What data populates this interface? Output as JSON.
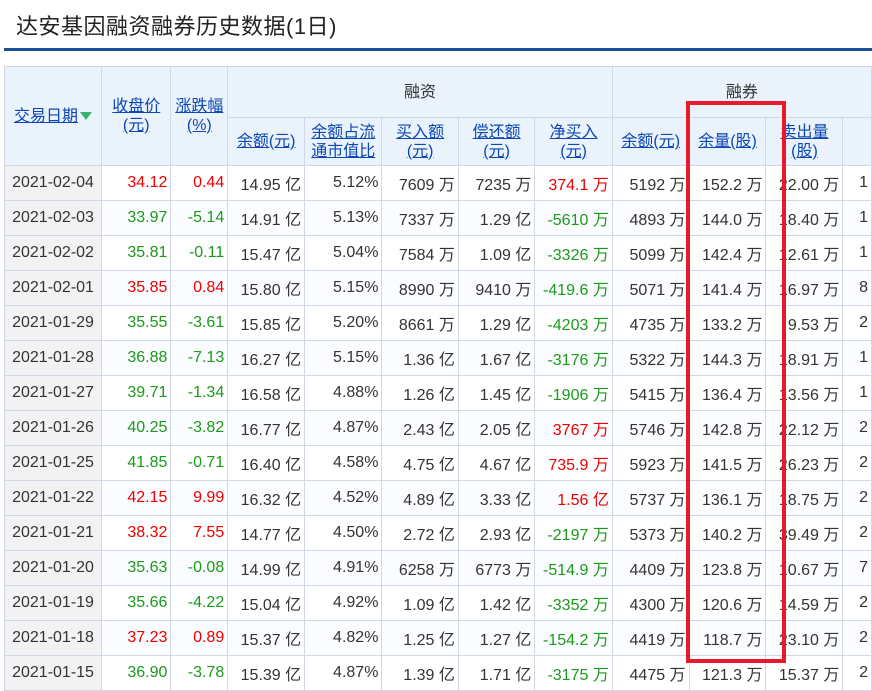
{
  "page": {
    "title": "达安基因融资融券历史数据(1日)"
  },
  "table": {
    "group_headers": {
      "financing": "融资",
      "securities_lending": "融券"
    },
    "columns": {
      "date": "交易日期",
      "close_line1": "收盘价",
      "close_line2": "(元)",
      "change_line1": "涨跌幅",
      "change_line2": "(%)",
      "fin_balance": "余额(元)",
      "fin_ratio_line1": "余额占流",
      "fin_ratio_line2": "通市值比",
      "fin_buy_line1": "买入额",
      "fin_buy_line2": "(元)",
      "fin_repay_line1": "偿还额",
      "fin_repay_line2": "(元)",
      "fin_net_line1": "净买入",
      "fin_net_line2": "(元)",
      "sl_balance": "余额(元)",
      "sl_volume": "余量(股)",
      "sl_sold_line1": "卖出量",
      "sl_sold_line2": "(股)",
      "sl_extra": ""
    },
    "rows": [
      {
        "date": "2021-02-04",
        "close": "34.12",
        "change": "0.44",
        "dir": "up",
        "fin_balance": "14.95 亿",
        "fin_ratio": "5.12%",
        "fin_buy": "7609 万",
        "fin_repay": "7235 万",
        "fin_net": "374.1 万",
        "net_dir": "up",
        "sl_balance": "5192 万",
        "sl_volume": "152.2 万",
        "sl_sold": "22.00 万",
        "sl_extra": "1"
      },
      {
        "date": "2021-02-03",
        "close": "33.97",
        "change": "-5.14",
        "dir": "down",
        "fin_balance": "14.91 亿",
        "fin_ratio": "5.13%",
        "fin_buy": "7337 万",
        "fin_repay": "1.29 亿",
        "fin_net": "-5610 万",
        "net_dir": "down",
        "sl_balance": "4893 万",
        "sl_volume": "144.0 万",
        "sl_sold": "18.40 万",
        "sl_extra": "1"
      },
      {
        "date": "2021-02-02",
        "close": "35.81",
        "change": "-0.11",
        "dir": "down",
        "fin_balance": "15.47 亿",
        "fin_ratio": "5.04%",
        "fin_buy": "7584 万",
        "fin_repay": "1.09 亿",
        "fin_net": "-3326 万",
        "net_dir": "down",
        "sl_balance": "5099 万",
        "sl_volume": "142.4 万",
        "sl_sold": "12.61 万",
        "sl_extra": "1"
      },
      {
        "date": "2021-02-01",
        "close": "35.85",
        "change": "0.84",
        "dir": "up",
        "fin_balance": "15.80 亿",
        "fin_ratio": "5.15%",
        "fin_buy": "8990 万",
        "fin_repay": "9410 万",
        "fin_net": "-419.6 万",
        "net_dir": "down",
        "sl_balance": "5071 万",
        "sl_volume": "141.4 万",
        "sl_sold": "16.97 万",
        "sl_extra": "8"
      },
      {
        "date": "2021-01-29",
        "close": "35.55",
        "change": "-3.61",
        "dir": "down",
        "fin_balance": "15.85 亿",
        "fin_ratio": "5.20%",
        "fin_buy": "8661 万",
        "fin_repay": "1.29 亿",
        "fin_net": "-4203 万",
        "net_dir": "down",
        "sl_balance": "4735 万",
        "sl_volume": "133.2 万",
        "sl_sold": "9.53 万",
        "sl_extra": "2"
      },
      {
        "date": "2021-01-28",
        "close": "36.88",
        "change": "-7.13",
        "dir": "down",
        "fin_balance": "16.27 亿",
        "fin_ratio": "5.15%",
        "fin_buy": "1.36 亿",
        "fin_repay": "1.67 亿",
        "fin_net": "-3176 万",
        "net_dir": "down",
        "sl_balance": "5322 万",
        "sl_volume": "144.3 万",
        "sl_sold": "18.91 万",
        "sl_extra": "1"
      },
      {
        "date": "2021-01-27",
        "close": "39.71",
        "change": "-1.34",
        "dir": "down",
        "fin_balance": "16.58 亿",
        "fin_ratio": "4.88%",
        "fin_buy": "1.26 亿",
        "fin_repay": "1.45 亿",
        "fin_net": "-1906 万",
        "net_dir": "down",
        "sl_balance": "5415 万",
        "sl_volume": "136.4 万",
        "sl_sold": "13.56 万",
        "sl_extra": "1"
      },
      {
        "date": "2021-01-26",
        "close": "40.25",
        "change": "-3.82",
        "dir": "down",
        "fin_balance": "16.77 亿",
        "fin_ratio": "4.87%",
        "fin_buy": "2.43 亿",
        "fin_repay": "2.05 亿",
        "fin_net": "3767 万",
        "net_dir": "up",
        "sl_balance": "5746 万",
        "sl_volume": "142.8 万",
        "sl_sold": "22.12 万",
        "sl_extra": "2"
      },
      {
        "date": "2021-01-25",
        "close": "41.85",
        "change": "-0.71",
        "dir": "down",
        "fin_balance": "16.40 亿",
        "fin_ratio": "4.58%",
        "fin_buy": "4.75 亿",
        "fin_repay": "4.67 亿",
        "fin_net": "735.9 万",
        "net_dir": "up",
        "sl_balance": "5923 万",
        "sl_volume": "141.5 万",
        "sl_sold": "26.23 万",
        "sl_extra": "2"
      },
      {
        "date": "2021-01-22",
        "close": "42.15",
        "change": "9.99",
        "dir": "up",
        "fin_balance": "16.32 亿",
        "fin_ratio": "4.52%",
        "fin_buy": "4.89 亿",
        "fin_repay": "3.33 亿",
        "fin_net": "1.56 亿",
        "net_dir": "up",
        "sl_balance": "5737 万",
        "sl_volume": "136.1 万",
        "sl_sold": "18.75 万",
        "sl_extra": "2"
      },
      {
        "date": "2021-01-21",
        "close": "38.32",
        "change": "7.55",
        "dir": "up",
        "fin_balance": "14.77 亿",
        "fin_ratio": "4.50%",
        "fin_buy": "2.72 亿",
        "fin_repay": "2.93 亿",
        "fin_net": "-2197 万",
        "net_dir": "down",
        "sl_balance": "5373 万",
        "sl_volume": "140.2 万",
        "sl_sold": "39.49 万",
        "sl_extra": "2"
      },
      {
        "date": "2021-01-20",
        "close": "35.63",
        "change": "-0.08",
        "dir": "down",
        "fin_balance": "14.99 亿",
        "fin_ratio": "4.91%",
        "fin_buy": "6258 万",
        "fin_repay": "6773 万",
        "fin_net": "-514.9 万",
        "net_dir": "down",
        "sl_balance": "4409 万",
        "sl_volume": "123.8 万",
        "sl_sold": "10.67 万",
        "sl_extra": "7"
      },
      {
        "date": "2021-01-19",
        "close": "35.66",
        "change": "-4.22",
        "dir": "down",
        "fin_balance": "15.04 亿",
        "fin_ratio": "4.92%",
        "fin_buy": "1.09 亿",
        "fin_repay": "1.42 亿",
        "fin_net": "-3352 万",
        "net_dir": "down",
        "sl_balance": "4300 万",
        "sl_volume": "120.6 万",
        "sl_sold": "14.59 万",
        "sl_extra": "2"
      },
      {
        "date": "2021-01-18",
        "close": "37.23",
        "change": "0.89",
        "dir": "up",
        "fin_balance": "15.37 亿",
        "fin_ratio": "4.82%",
        "fin_buy": "1.25 亿",
        "fin_repay": "1.27 亿",
        "fin_net": "-154.2 万",
        "net_dir": "down",
        "sl_balance": "4419 万",
        "sl_volume": "118.7 万",
        "sl_sold": "23.10 万",
        "sl_extra": "2"
      },
      {
        "date": "2021-01-15",
        "close": "36.90",
        "change": "-3.78",
        "dir": "down",
        "fin_balance": "15.39 亿",
        "fin_ratio": "4.87%",
        "fin_buy": "1.39 亿",
        "fin_repay": "1.71 亿",
        "fin_net": "-3175 万",
        "net_dir": "down",
        "sl_balance": "4475 万",
        "sl_volume": "121.3 万",
        "sl_sold": "15.37 万",
        "sl_extra": "2"
      }
    ]
  },
  "colors": {
    "up": "#ee0000",
    "down": "#1b9a1b",
    "header_bg": "#eaf2fb",
    "accent": "#1d4e9a",
    "highlight_box": "#e8192c"
  },
  "icons": {
    "sort": "sort-down-arrow-icon"
  }
}
